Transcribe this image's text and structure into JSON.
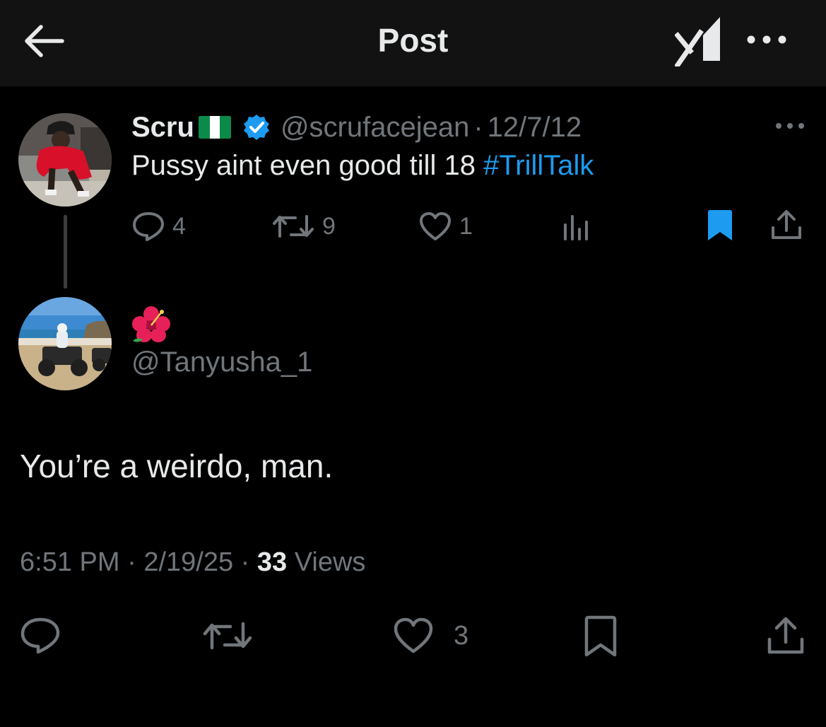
{
  "header": {
    "title": "Post",
    "back_icon": "arrow-left-icon",
    "grok_icon": "grok-icon",
    "more_icon": "more-horizontal-icon"
  },
  "parent_post": {
    "display_name": "Scru",
    "flag": "nigeria-flag",
    "verified": true,
    "handle": "@scrufacejean",
    "separator": "·",
    "date": "12/7/12",
    "text": "Pussy aint even good till 18",
    "hashtag": "#TrillTalk",
    "actions": {
      "replies": "4",
      "reposts": "9",
      "likes": "1",
      "bookmarked": true
    }
  },
  "reply_post": {
    "display_name_emoji": "hibiscus",
    "handle": "@Tanyusha_1",
    "text": "You’re a weirdo, man.",
    "time": "6:51 PM",
    "date": "2/19/25",
    "separator": "·",
    "views_count": "33",
    "views_label": "Views",
    "actions": {
      "likes": "3"
    }
  },
  "colors": {
    "background": "#000000",
    "header_background": "#121212",
    "text_primary": "#e7e9ea",
    "text_secondary": "#71767b",
    "accent_blue": "#1d9bf0"
  }
}
